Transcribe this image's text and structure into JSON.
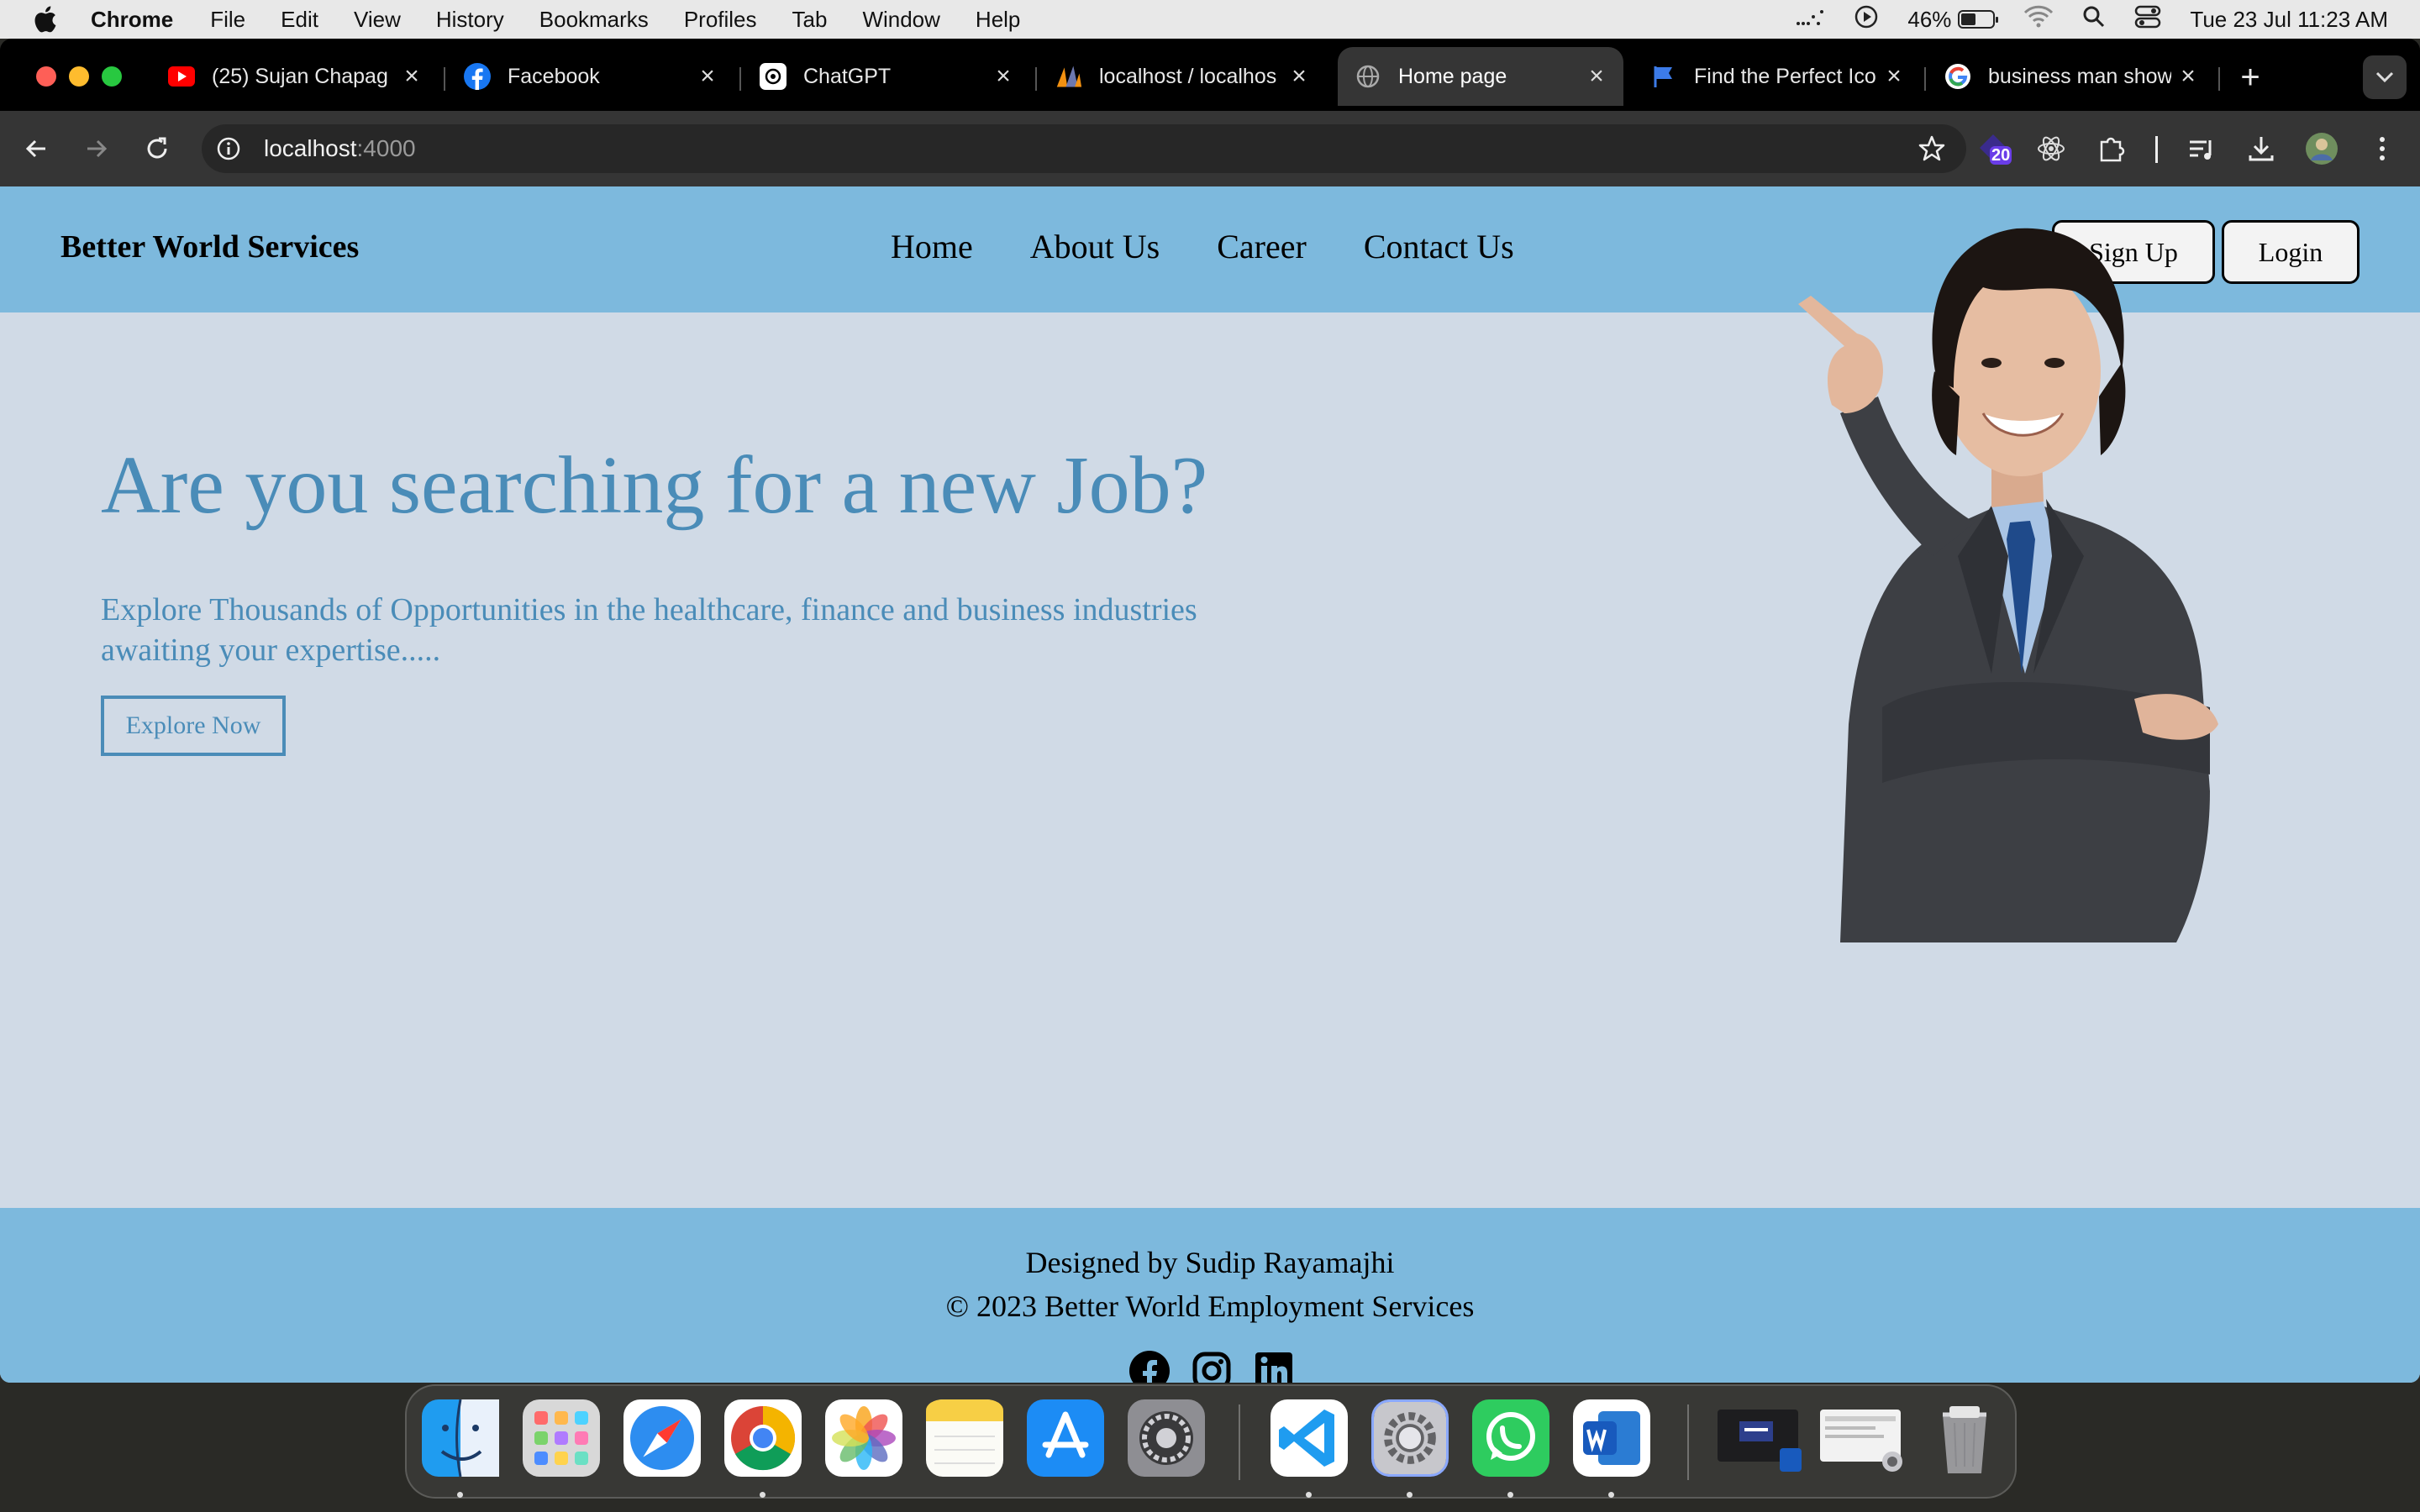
{
  "menubar": {
    "app_name": "Chrome",
    "menus": [
      "File",
      "Edit",
      "View",
      "History",
      "Bookmarks",
      "Profiles",
      "Tab",
      "Window",
      "Help"
    ],
    "battery_percent": "46%",
    "battery_level": 0.46,
    "datetime": "Tue 23 Jul  11:23 AM"
  },
  "browser": {
    "tabs": [
      {
        "title": "(25) Sujan Chapag",
        "icon": "youtube-icon"
      },
      {
        "title": "Facebook",
        "icon": "facebook-icon"
      },
      {
        "title": "ChatGPT",
        "icon": "chatgpt-icon"
      },
      {
        "title": "localhost / localhos",
        "icon": "phpmyadmin-icon"
      },
      {
        "title": "Home page",
        "icon": "globe-icon",
        "active": true
      },
      {
        "title": "Find the Perfect Ico",
        "icon": "flag-icon"
      },
      {
        "title": "business man show",
        "icon": "google-icon"
      }
    ],
    "url_host": "localhost",
    "url_port": ":4000",
    "extension_badge": "20"
  },
  "site": {
    "brand": "Better World Services",
    "nav": {
      "home": "Home",
      "about": "About Us",
      "career": "Career",
      "contact": "Contact Us"
    },
    "signup_label": "Sign Up",
    "login_label": "Login",
    "hero": {
      "title": "Are you searching for a new Job?",
      "subtitle": "Explore Thousands of Opportunities in the healthcare, finance and business industries awaiting your expertise.....",
      "cta": "Explore Now"
    },
    "footer": {
      "designer": "Designed by Sudip Rayamajhi",
      "copyright": "© 2023 Better World Employment Services"
    }
  },
  "colors": {
    "header_bg": "#7db9dd",
    "page_bg": "#d0dae6",
    "accent_text": "#4a8cb8"
  },
  "dock": {
    "apps": [
      "finder-icon",
      "launchpad-icon",
      "safari-icon",
      "chrome-icon",
      "photos-icon",
      "notes-icon",
      "app-store-icon",
      "system-settings-icon",
      "vscode-icon",
      "system-preferences-icon",
      "whatsapp-icon",
      "word-icon",
      "window-preview-icon",
      "window-preview-icon",
      "trash-icon"
    ]
  }
}
